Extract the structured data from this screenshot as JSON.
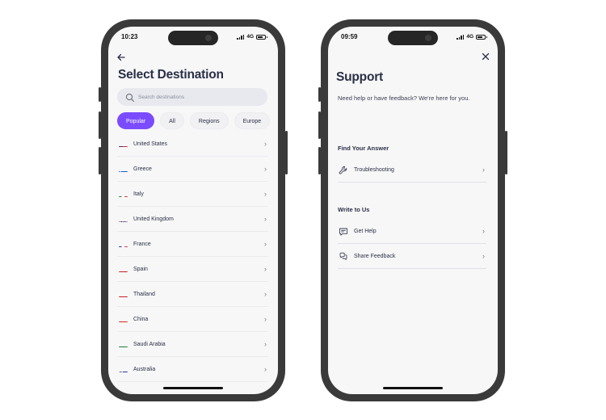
{
  "left_phone": {
    "status": {
      "time": "10:23",
      "network": "4G"
    },
    "title": "Select Destination",
    "search": {
      "placeholder": "Search destinations"
    },
    "chips": [
      "Popular",
      "All",
      "Regions",
      "Europe"
    ],
    "active_chip": "Popular",
    "destinations": [
      {
        "label": "United States",
        "flag": "us-flag-icon"
      },
      {
        "label": "Greece",
        "flag": "greece-flag-icon"
      },
      {
        "label": "Italy",
        "flag": "italy-flag-icon"
      },
      {
        "label": "United Kingdom",
        "flag": "uk-flag-icon"
      },
      {
        "label": "France",
        "flag": "france-flag-icon"
      },
      {
        "label": "Spain",
        "flag": "spain-flag-icon"
      },
      {
        "label": "Thailand",
        "flag": "thailand-flag-icon"
      },
      {
        "label": "China",
        "flag": "china-flag-icon"
      },
      {
        "label": "Saudi Arabia",
        "flag": "saudi-arabia-flag-icon"
      },
      {
        "label": "Australia",
        "flag": "australia-flag-icon"
      }
    ],
    "colors": {
      "accent": "#7b4cff"
    }
  },
  "right_phone": {
    "status": {
      "time": "09:59",
      "network": "4G"
    },
    "title": "Support",
    "intro": "Need help or have feedback? We're here for you.",
    "find_section": {
      "heading": "Find Your Answer",
      "items": [
        {
          "label": "Troubleshooting",
          "icon": "wrench-icon"
        }
      ]
    },
    "write_section": {
      "heading": "Write to Us",
      "items": [
        {
          "label": "Get Help",
          "icon": "chat-help-icon"
        },
        {
          "label": "Share Feedback",
          "icon": "feedback-icon"
        }
      ]
    }
  }
}
